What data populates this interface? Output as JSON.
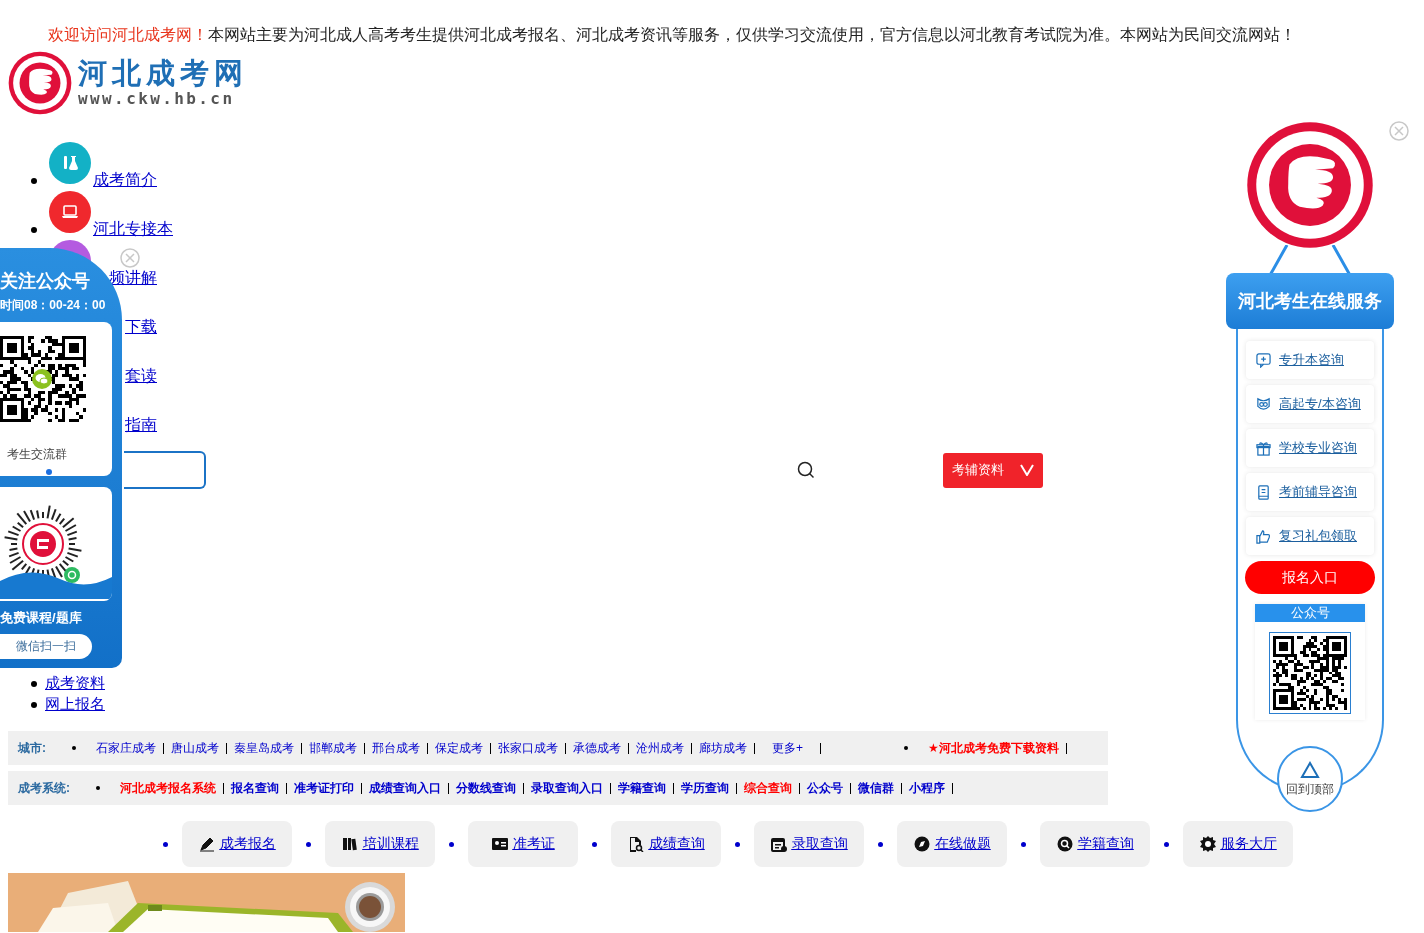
{
  "notice": {
    "welcome": "欢迎访问河北成考网！",
    "text": "本网站主要为河北成人高考考生提供河北成考报名、河北成考资讯等服务，仅供学习交流使用，官方信息以河北教育考试院为准。本网站为民间交流网站！"
  },
  "logo": {
    "title": "河北成考网",
    "url": "www.ckw.hb.cn"
  },
  "nav": [
    {
      "label": "成考简介",
      "kind": "flask",
      "color": "#13b1c6",
      "bullet": true
    },
    {
      "label": "河北专接本",
      "kind": "laptop",
      "color": "#f0282d",
      "bullet": true
    },
    {
      "label": "频讲解",
      "kind": "plain",
      "color": "#b45be0",
      "bullet": false
    },
    {
      "label": "下载",
      "bullet": false
    },
    {
      "label": "套读",
      "bullet": false
    },
    {
      "label": "指南",
      "bullet": false
    }
  ],
  "search": {
    "button": "考辅资料"
  },
  "nav_more": [
    "成考资料",
    "网上报名"
  ],
  "city_bar": {
    "label": "城市:",
    "items": [
      "石家庄成考",
      "唐山成考",
      "秦皇岛成考",
      "邯郸成考",
      "邢台成考",
      "保定成考",
      "张家口成考",
      "承德成考",
      "沧州成考",
      "廊坊成考"
    ],
    "more": "更多+",
    "promo": "★河北成考免费下载资料"
  },
  "system_bar": {
    "label": "成考系统:",
    "items": [
      {
        "text": "河北成考报名系统",
        "highlight": true
      },
      {
        "text": "报名查询",
        "highlight": false
      },
      {
        "text": "准考证打印",
        "highlight": false
      },
      {
        "text": "成绩查询入口",
        "highlight": false
      },
      {
        "text": "分数线查询",
        "highlight": false
      },
      {
        "text": "录取查询入口",
        "highlight": false
      },
      {
        "text": "学籍查询",
        "highlight": false
      },
      {
        "text": "学历查询",
        "highlight": false
      },
      {
        "text": "综合查询",
        "highlight": true
      },
      {
        "text": "公众号",
        "highlight": false
      },
      {
        "text": "微信群",
        "highlight": false
      },
      {
        "text": "小程序",
        "highlight": false
      }
    ]
  },
  "quick_links": [
    {
      "label": "成考报名",
      "kind": "pen"
    },
    {
      "label": "培训课程",
      "kind": "book"
    },
    {
      "label": "准考证",
      "kind": "card"
    },
    {
      "label": "成绩查询",
      "kind": "doc"
    },
    {
      "label": "录取查询",
      "kind": "calendar"
    },
    {
      "label": "在线做题",
      "kind": "compass"
    },
    {
      "label": "学籍查询",
      "kind": "search"
    },
    {
      "label": "服务大厅",
      "kind": "badge"
    }
  ],
  "wechat_panel": {
    "title": "关注公众号",
    "hours": "时间08：00-24：00",
    "qr_caption": "考生交流群",
    "code_caption": "免费课程/题库",
    "button": "微信扫一扫"
  },
  "service_panel": {
    "title": "河北考生在线服务",
    "items": [
      {
        "label": "专升本咨询",
        "kind": "chat"
      },
      {
        "label": "高起专/本咨询",
        "kind": "owl"
      },
      {
        "label": "学校专业咨询",
        "kind": "gift"
      },
      {
        "label": "考前辅导咨询",
        "kind": "book"
      },
      {
        "label": "复习礼包领取",
        "kind": "thumb"
      }
    ],
    "signup": "报名入口",
    "qr_title": "公众号",
    "back_top": "回到顶部"
  }
}
